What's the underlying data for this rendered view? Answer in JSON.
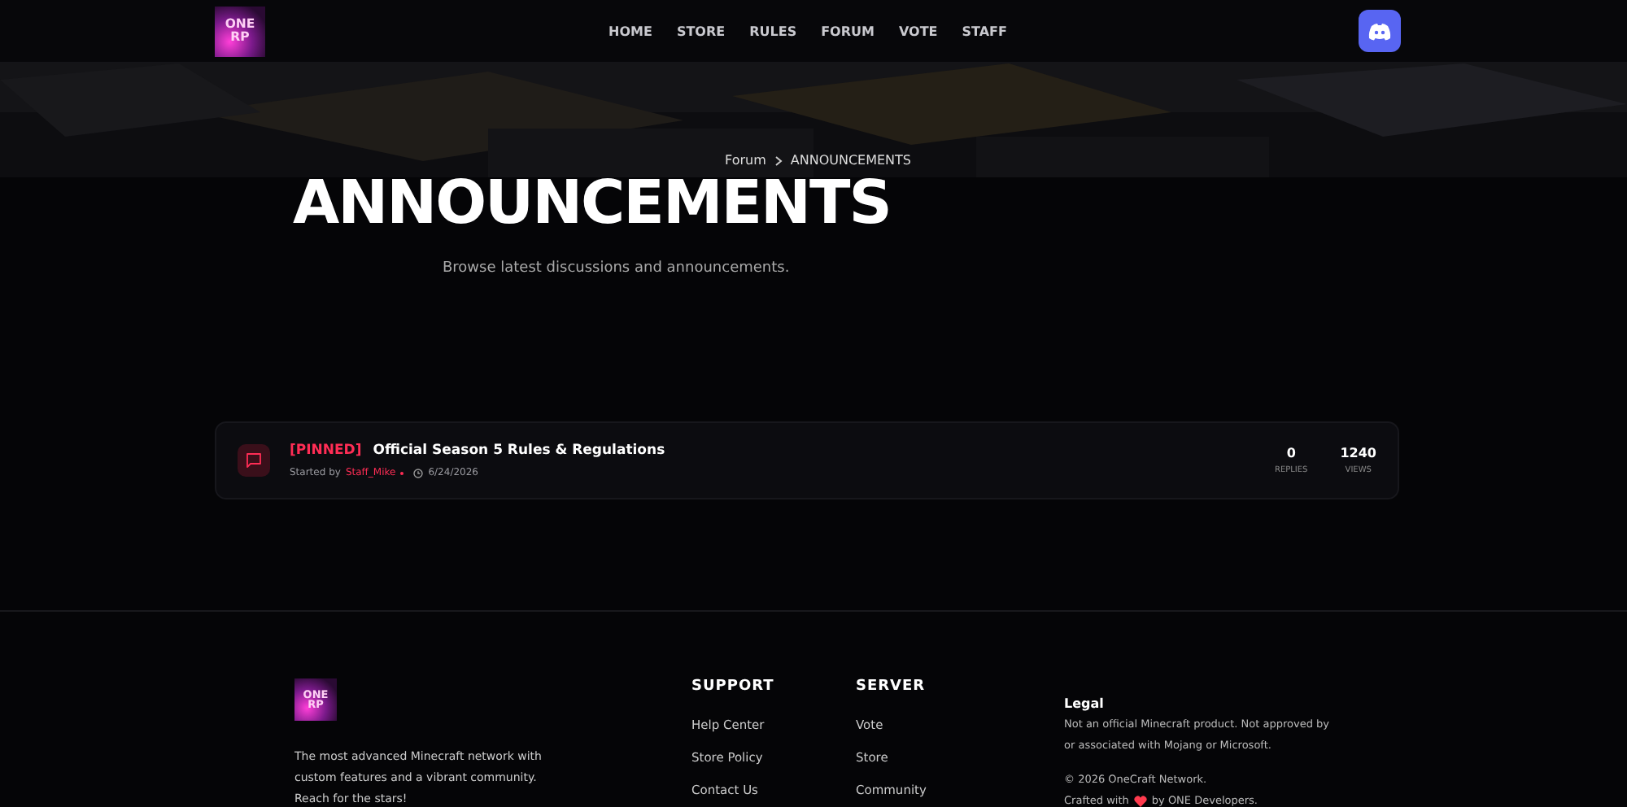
{
  "header": {
    "logo_text": "ONE RP",
    "nav": [
      {
        "label": "HOME",
        "selected": false
      },
      {
        "label": "STORE",
        "selected": false
      },
      {
        "label": "RULES",
        "selected": false
      },
      {
        "label": "FORUM",
        "selected": false
      },
      {
        "label": "VOTE",
        "selected": false
      },
      {
        "label": "STAFF",
        "selected": false
      }
    ]
  },
  "hero": {
    "breadcrumb": [
      "Forum",
      "ANNOUNCEMENTS"
    ],
    "title": "ANNOUNCEMENTS",
    "subtitle": "Browse latest discussions and announcements."
  },
  "threads": [
    {
      "tag": "[PINNED]",
      "title": "Official Season 5 Rules & Regulations",
      "started_by": "Started by",
      "author": "Staff_Mike",
      "date": "6/24/2026",
      "stats": [
        {
          "value": "0",
          "label": "REPLIES"
        },
        {
          "value": "1240",
          "label": "VIEWS"
        }
      ]
    }
  ],
  "footer": {
    "logo_text": "ONE RP",
    "about": "The most advanced Minecraft network with custom features and a vibrant community. Reach for the stars!",
    "columns": [
      {
        "title": "SUPPORT",
        "links": [
          "Help Center",
          "Store Policy",
          "Contact Us"
        ]
      },
      {
        "title": "SERVER",
        "links": [
          "Vote",
          "Store",
          "Community"
        ]
      }
    ],
    "legal": {
      "title": "Legal",
      "text": "Not an official Minecraft product. Not approved by or associated with Mojang or Microsoft.",
      "copyright": "© 2026 OneCraft Network.",
      "crafted_before": "Crafted with",
      "crafted_after": "by ONE Developers."
    }
  }
}
